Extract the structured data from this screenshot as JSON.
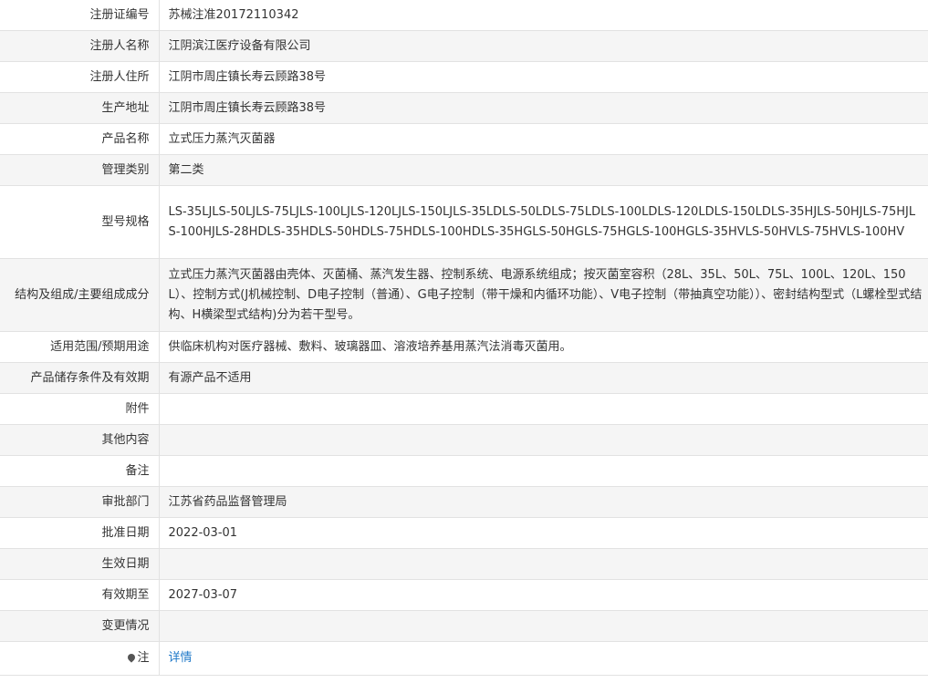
{
  "rows": [
    {
      "label": "注册证编号",
      "value": "苏械注准20172110342"
    },
    {
      "label": "注册人名称",
      "value": "江阴滨江医疗设备有限公司"
    },
    {
      "label": "注册人住所",
      "value": "江阴市周庄镇长寿云顾路38号"
    },
    {
      "label": "生产地址",
      "value": "江阴市周庄镇长寿云顾路38号"
    },
    {
      "label": "产品名称",
      "value": "立式压力蒸汽灭菌器"
    },
    {
      "label": "管理类别",
      "value": "第二类"
    },
    {
      "label": "型号规格",
      "value": "LS-35LJLS-50LJLS-75LJLS-100LJLS-120LJLS-150LJLS-35LDLS-50LDLS-75LDLS-100LDLS-120LDLS-150LDLS-35HJLS-50HJLS-75HJLS-100HJLS-28HDLS-35HDLS-50HDLS-75HDLS-100HDLS-35HGLS-50HGLS-75HGLS-100HGLS-35HVLS-50HVLS-75HVLS-100HV"
    },
    {
      "label": "结构及组成/主要组成成分",
      "value": "立式压力蒸汽灭菌器由壳体、灭菌桶、蒸汽发生器、控制系统、电源系统组成；按灭菌室容积（28L、35L、50L、75L、100L、120L、150L）、控制方式(J机械控制、D电子控制（普通）、G电子控制（带干燥和内循环功能）、V电子控制（带抽真空功能））、密封结构型式（L螺栓型式结构、H横梁型式结构)分为若干型号。"
    },
    {
      "label": "适用范围/预期用途",
      "value": "供临床机构对医疗器械、敷料、玻璃器皿、溶液培养基用蒸汽法消毒灭菌用。"
    },
    {
      "label": "产品储存条件及有效期",
      "value": "有源产品不适用"
    },
    {
      "label": "附件",
      "value": ""
    },
    {
      "label": "其他内容",
      "value": ""
    },
    {
      "label": "备注",
      "value": ""
    },
    {
      "label": "审批部门",
      "value": "江苏省药品监督管理局"
    },
    {
      "label": "批准日期",
      "value": "2022-03-01"
    },
    {
      "label": "生效日期",
      "value": ""
    },
    {
      "label": "有效期至",
      "value": "2027-03-07"
    },
    {
      "label": "变更情况",
      "value": ""
    }
  ],
  "note": {
    "label": "注",
    "link_text": "详情",
    "icon": "location-pin-icon"
  }
}
